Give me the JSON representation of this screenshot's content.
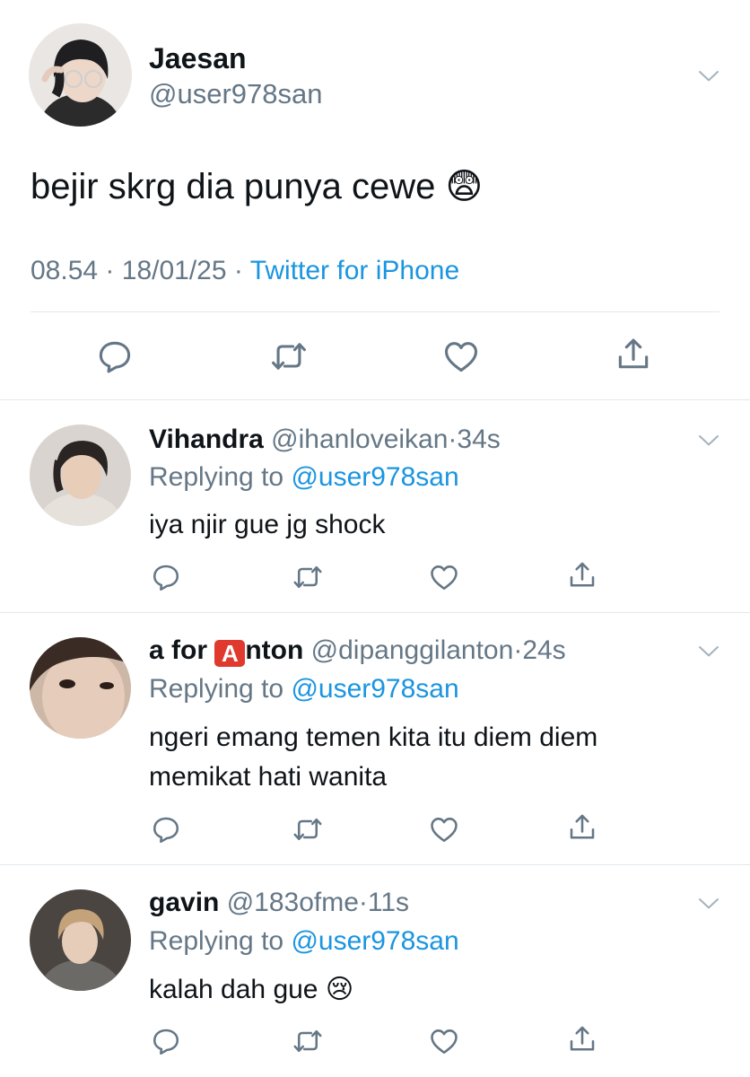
{
  "main_tweet": {
    "author_name": "Jaesan",
    "handle": "@user978san",
    "text": "bejir skrg dia punya cewe",
    "text_emoji": "😨",
    "time": "08.54",
    "date": "18/01/25",
    "source": "Twitter for iPhone",
    "sep": "·"
  },
  "replies": [
    {
      "name": "Vihandra",
      "handle": "@ihanloveikan",
      "time": "34s",
      "replying_label": "Replying to",
      "replying_handle": "@user978san",
      "text": "iya njir gue jg shock"
    },
    {
      "name_prefix": "a for",
      "name_badge": "A",
      "name_suffix": "nton",
      "handle": "@dipanggilanton",
      "time": "24s",
      "replying_label": "Replying to",
      "replying_handle": "@user978san",
      "text_line1": "ngeri emang temen kita itu diem diem",
      "text_line2": "memikat hati wanita"
    },
    {
      "name": "gavin",
      "handle": "@183ofme",
      "time": "11s",
      "replying_label": "Replying to",
      "replying_handle": "@user978san",
      "text": "kalah dah gue",
      "text_emoji": "😢"
    }
  ],
  "colors": {
    "text": "#0f1419",
    "muted": "#657786",
    "link": "#1b95e0",
    "divider": "#e1e8ed",
    "badge": "#e0392d"
  },
  "icons": [
    "chevron-down-icon",
    "reply-icon",
    "retweet-icon",
    "like-icon",
    "share-icon"
  ]
}
